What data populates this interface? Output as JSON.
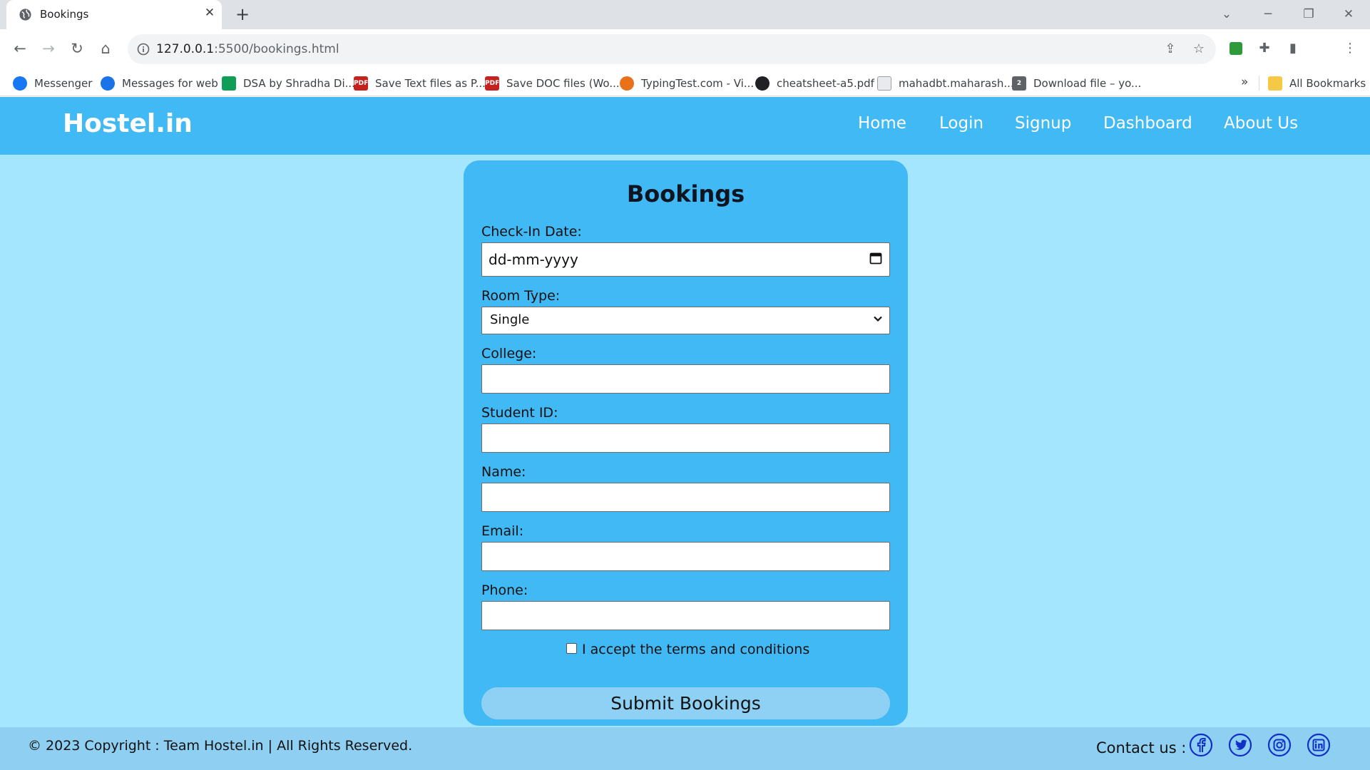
{
  "browser": {
    "tab_title": "Bookings",
    "new_tab_symbol": "+",
    "url_host": "127.0.0.1",
    "url_rest": ":5500/bookings.html",
    "bookmarks": [
      {
        "label": "Messenger",
        "icon": "messenger-icon",
        "color": "#1877f2"
      },
      {
        "label": "Messages for web",
        "icon": "messages-icon",
        "color": "#1a73e8"
      },
      {
        "label": "DSA by Shradha Di...",
        "icon": "sheets-icon",
        "color": "#0f9d58"
      },
      {
        "label": "Save Text files as P...",
        "icon": "pdf-icon",
        "color": "#c5221f"
      },
      {
        "label": "Save DOC files (Wo...",
        "icon": "pdf-icon",
        "color": "#c5221f"
      },
      {
        "label": "TypingTest.com - Vi...",
        "icon": "typingtest-icon",
        "color": "#e8711a"
      },
      {
        "label": "cheatsheet-a5.pdf",
        "icon": "cheatsheet-icon",
        "color": "#202124"
      },
      {
        "label": "mahadbt.maharash...",
        "icon": "document-icon",
        "color": "#9aa0a6"
      },
      {
        "label": "Download file – yo...",
        "icon": "download-icon",
        "color": "#5f6368"
      }
    ],
    "bookmarks_more": "»",
    "all_bookmarks": "All Bookmarks"
  },
  "site": {
    "brand": "Hostel.in",
    "nav": [
      "Home",
      "Login",
      "Signup",
      "Dashboard",
      "About Us"
    ]
  },
  "form": {
    "title": "Bookings",
    "checkin_label": "Check-In Date:",
    "checkin_placeholder": "dd-mm-yyyy",
    "room_type_label": "Room Type:",
    "room_type_value": "Single",
    "college_label": "College:",
    "college_value": "",
    "student_id_label": "Student ID:",
    "student_id_value": "",
    "name_label": "Name:",
    "name_value": "",
    "email_label": "Email:",
    "email_value": "",
    "phone_label": "Phone:",
    "phone_value": "",
    "terms_label": "I accept the terms and conditions",
    "terms_checked": false,
    "submit_label": "Submit Bookings"
  },
  "footer": {
    "copyright": "© 2023 Copyright : Team Hostel.in | All Rights Reserved.",
    "contact_label": "Contact us :",
    "socials": [
      "facebook-icon",
      "twitter-icon",
      "instagram-icon",
      "linkedin-icon"
    ]
  },
  "colors": {
    "page_bg": "#a3e6fd",
    "navbar_bg": "#40b9f5",
    "card_bg": "#41b9f5",
    "submit_bg": "#8ed1f4",
    "footer_bg": "#8ecff2",
    "social_blue": "#1030c8"
  }
}
